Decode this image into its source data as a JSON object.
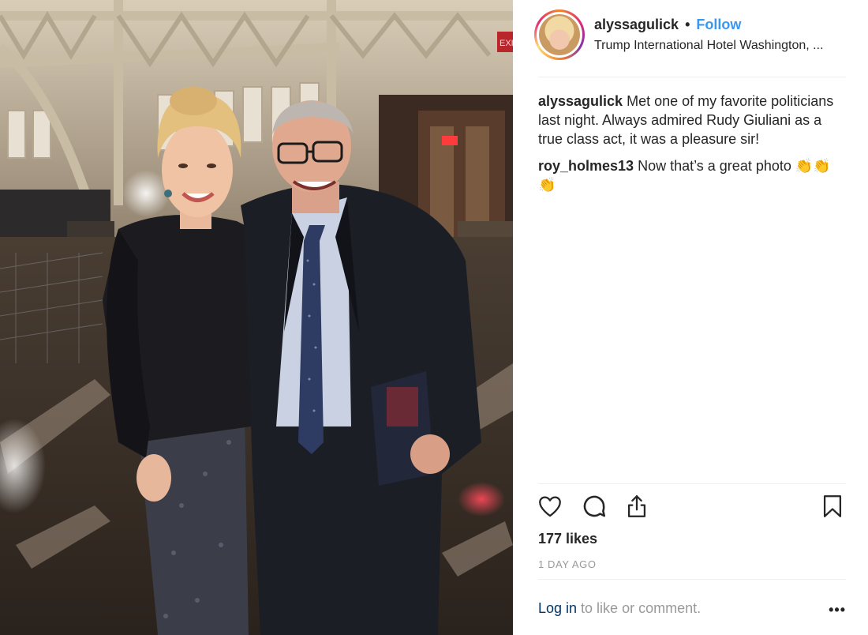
{
  "post": {
    "username": "alyssagulick",
    "separator": "•",
    "follow_label": "Follow",
    "location": "Trump International Hotel Washington, ..."
  },
  "comments": [
    {
      "user": "alyssagulick",
      "text": "Met one of my favorite politicians last night. Always admired Rudy Giuliani as a true class act, it was a pleasure sir!"
    },
    {
      "user": "roy_holmes13",
      "text": "Now that’s a great photo 👏👏👏"
    }
  ],
  "actions": {
    "like_icon": "heart-icon",
    "comment_icon": "comment-icon",
    "share_icon": "share-icon",
    "save_icon": "bookmark-icon"
  },
  "likes": "177 likes",
  "timestamp": "1 DAY AGO",
  "footer": {
    "login_label": "Log in",
    "rest_text": " to like or comment.",
    "more_label": "•••"
  },
  "colors": {
    "link": "#3897f0",
    "login": "#003569",
    "muted": "#999999",
    "text": "#262626"
  },
  "photo": {
    "exit_sign": "EXIT"
  }
}
